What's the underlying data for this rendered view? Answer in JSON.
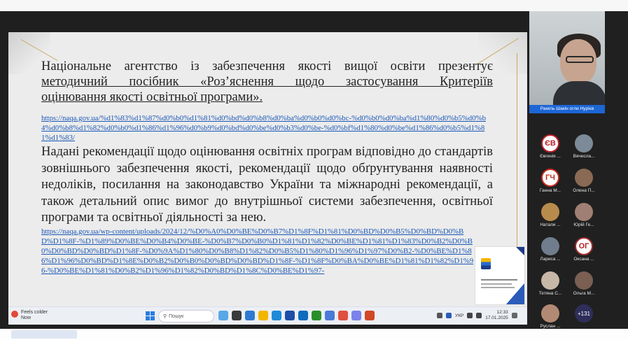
{
  "slide": {
    "title_line1": "Національне агентство із забезпечення якості вищої освіти презентує",
    "title_line2": "методичний посібник «Роз’яснення щодо застосування Критеріїв",
    "title_line3": "оцінювання якості освітньої програми».",
    "link1": "https://naqa.gov.ua/%d1%83%d1%87%d0%b0%d1%81%d0%bd%d0%b8%d0%ba%d0%b0%d0%bc-%d0%b0%d0%ba%d1%80%d0%b5%d0%b4%d0%b8%d1%82%d0%b0%d1%86%d1%96%d0%b9%d0%bd%d0%be%d0%b3%d0%be-%d0%bf%d1%80%d0%be%d1%86%d0%b5%d1%81%d1%83/",
    "body": "Надані рекомендації щодо оцінювання освітніх програм відповідно до стандартів зовнішнього забезпечення якості, рекомендації щодо обґрунтування наявності недоліків, посилання на законодавство України та міжнародні рекомендації, а також детальний опис вимог до внутрішньої системи забезпечення, освітньої програми та освітньої діяльності за нею.",
    "link2": "https://naqa.gov.ua/wp-content/uploads/2024/12/%D0%A0%D0%BE%D0%B7%D1%8F%D1%81%D0%BD%D0%B5%D0%BD%D0%BD%D1%8F-%D1%89%D0%BE%D0%B4%D0%BE-%D0%B7%D0%B0%D1%81%D1%82%D0%BE%D1%81%D1%83%D0%B2%D0%B0%D0%BD%D0%BD%D1%8F-%D0%9A%D1%80%D0%B8%D1%82%D0%B5%D1%80%D1%96%D1%97%D0%B2-%D0%BE%D1%86%D1%96%D0%BD%D1%8E%D0%B2%D0%B0%D0%BD%D0%BD%D1%8F-%D1%8F%D0%BA%D0%BE%D1%81%D1%82%D1%96-%D0%BE%D1%81%D0%B2%D1%96%D1%82%D0%BD%D1%8C%D0%BE%D1%97-"
  },
  "taskbar": {
    "weather_title": "Feels colder",
    "weather_sub": "Now",
    "search_placeholder": "Пошук",
    "lang": "УКР",
    "time": "12:33",
    "date": "17.01.2025"
  },
  "participants": {
    "speaker_name": "Раміль Шакін огли Нурієв",
    "tiles": [
      {
        "initials": "ЄВ",
        "name": "Євгенія ..."
      },
      {
        "initials": "",
        "name": "Вячесла..."
      },
      {
        "initials": "ГЧ",
        "name": "Ганна М..."
      },
      {
        "initials": "",
        "name": "Олена П..."
      },
      {
        "initials": "",
        "name": "Натали ..."
      },
      {
        "initials": "",
        "name": "Юрій Ге..."
      },
      {
        "initials": "",
        "name": "Лариса ..."
      },
      {
        "initials": "ОГ",
        "name": "Оксана ..."
      },
      {
        "initials": "",
        "name": "Тетяна С..."
      },
      {
        "initials": "",
        "name": "Ольга М..."
      },
      {
        "initials": "",
        "name": "Руслан ..."
      },
      {
        "initials": "+131",
        "name": ""
      }
    ]
  },
  "colors": {
    "link": "#1b58b8",
    "speaker_bar": "#1c66d6",
    "accent_gold": "#c8aa62"
  }
}
